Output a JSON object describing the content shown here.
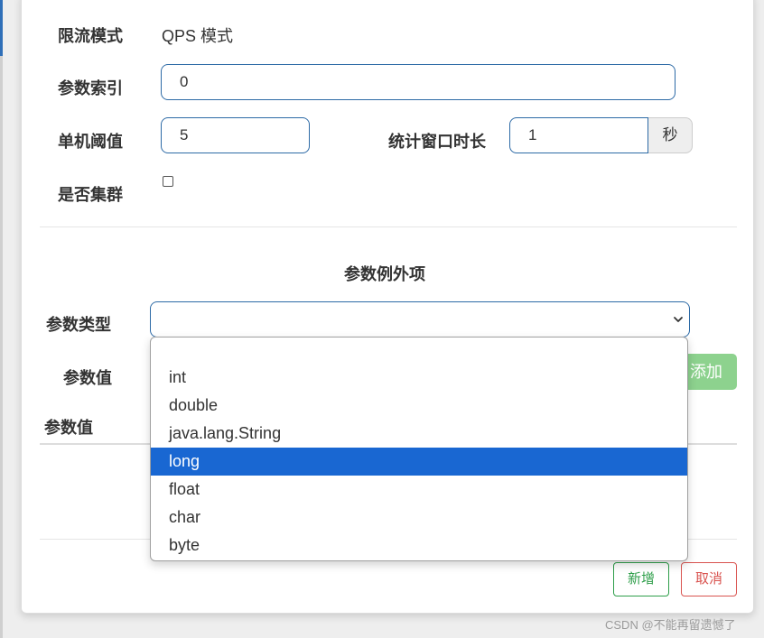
{
  "form": {
    "mode_label": "限流模式",
    "mode_value": "QPS 模式",
    "param_index_label": "参数索引",
    "param_index_value": "0",
    "threshold_label": "单机阈值",
    "threshold_value": "5",
    "window_label": "统计窗口时长",
    "window_value": "1",
    "window_unit": "秒",
    "cluster_label": "是否集群",
    "cluster_checked": false
  },
  "exceptions": {
    "title": "参数例外项",
    "type_label": "参数类型",
    "type_selected": "",
    "value_label": "参数值",
    "add_button": "添加",
    "table_header_value": "参数值"
  },
  "dropdown": {
    "options": [
      "",
      "int",
      "double",
      "java.lang.String",
      "long",
      "float",
      "char",
      "byte"
    ],
    "highlighted": "long"
  },
  "footer": {
    "new_button": "新增",
    "cancel_button": "取消"
  },
  "watermark": "CSDN @不能再留遗憾了",
  "colors": {
    "border_blue": "#2d6aa6",
    "highlight_blue": "#1967d2",
    "success_green": "#2e9e4a",
    "add_green": "#8dd28e",
    "danger_red": "#d9534f"
  }
}
